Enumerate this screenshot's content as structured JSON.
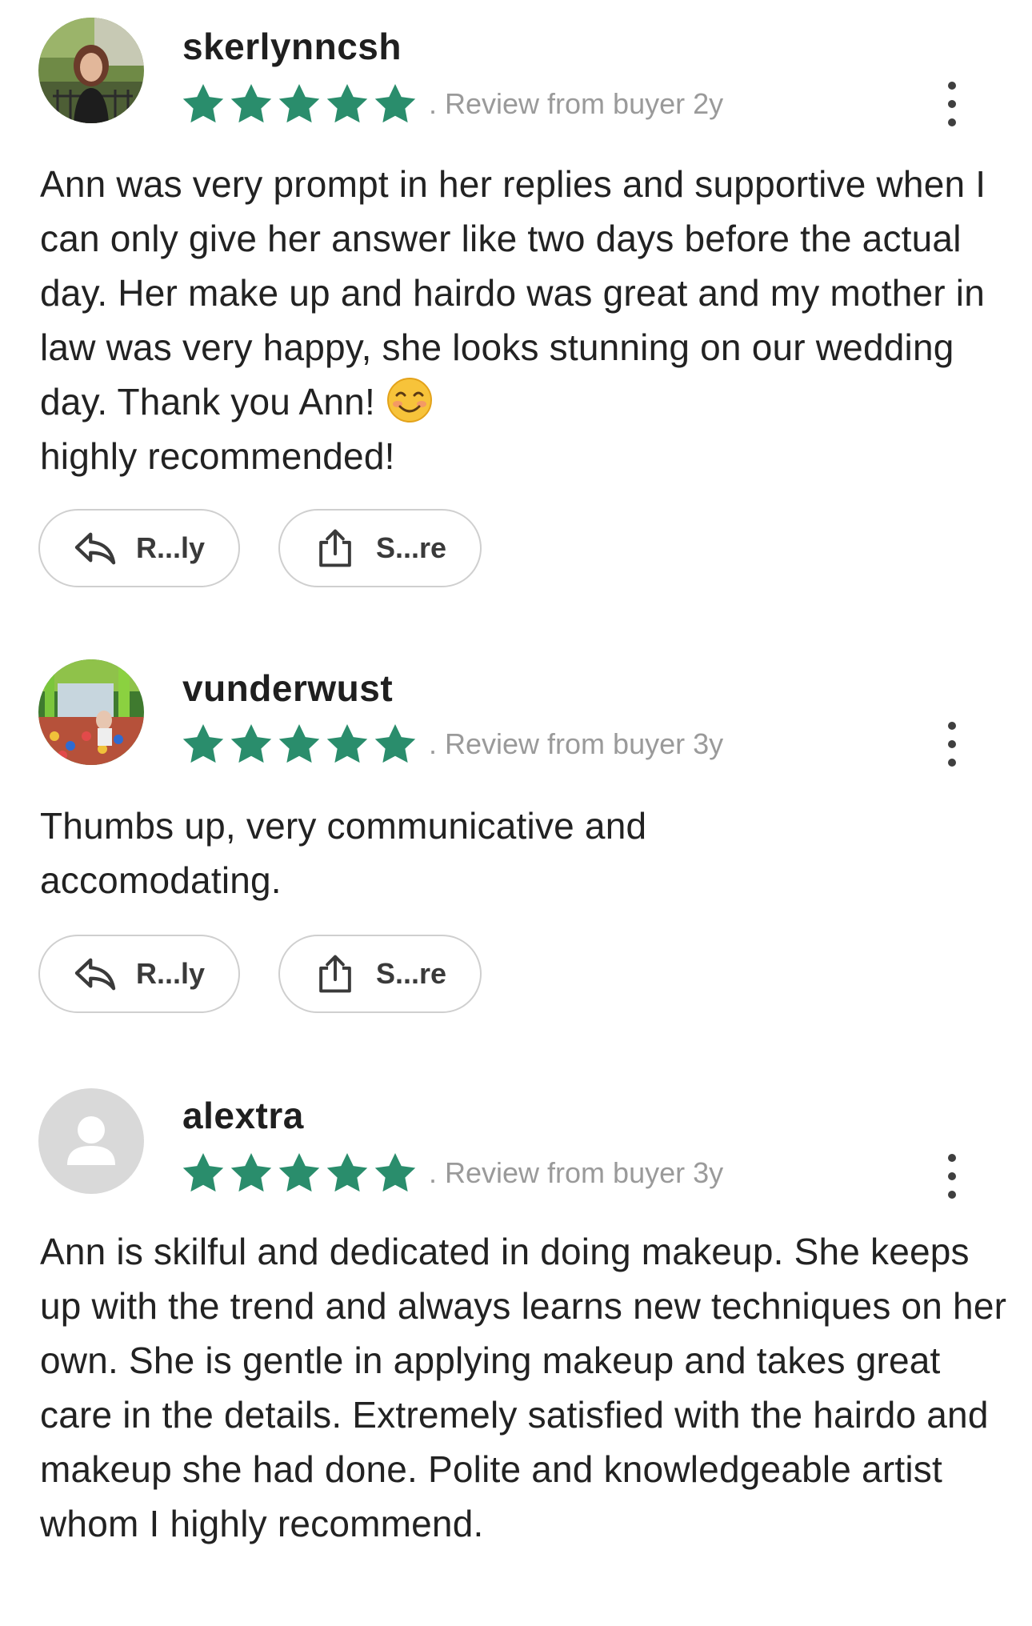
{
  "theme": {
    "star_color": "#2a8d6c",
    "meta_color": "#9a9a9a"
  },
  "reviews": [
    {
      "username": "skerlynncsh",
      "rating": 5,
      "meta": ". Review from buyer  2y",
      "text": "Ann was very prompt in her replies and supportive when I can only give her answer like two days before the actual day. Her make up and hairdo was great and my mother in law was very happy, she looks stunning on our wedding day. Thank you Ann!",
      "text_tail": "highly recommended!",
      "emoji": "smiling-face-emoji",
      "reply_label": "R...ly",
      "share_label": "S...re"
    },
    {
      "username": "vunderwust",
      "rating": 5,
      "meta": ". Review from buyer  3y",
      "text": "Thumbs up, very communicative and accomodating.",
      "reply_label": "R...ly",
      "share_label": "S...re"
    },
    {
      "username": "alextra",
      "rating": 5,
      "meta": ". Review from buyer  3y",
      "text": "Ann is skilful and dedicated in doing makeup. She keeps up with the trend and always learns new techniques on her own. She is gentle in applying makeup and takes great care in the details. Extremely satisfied with the hairdo and makeup she had done. Polite and knowledgeable artist whom I highly recommend."
    }
  ]
}
